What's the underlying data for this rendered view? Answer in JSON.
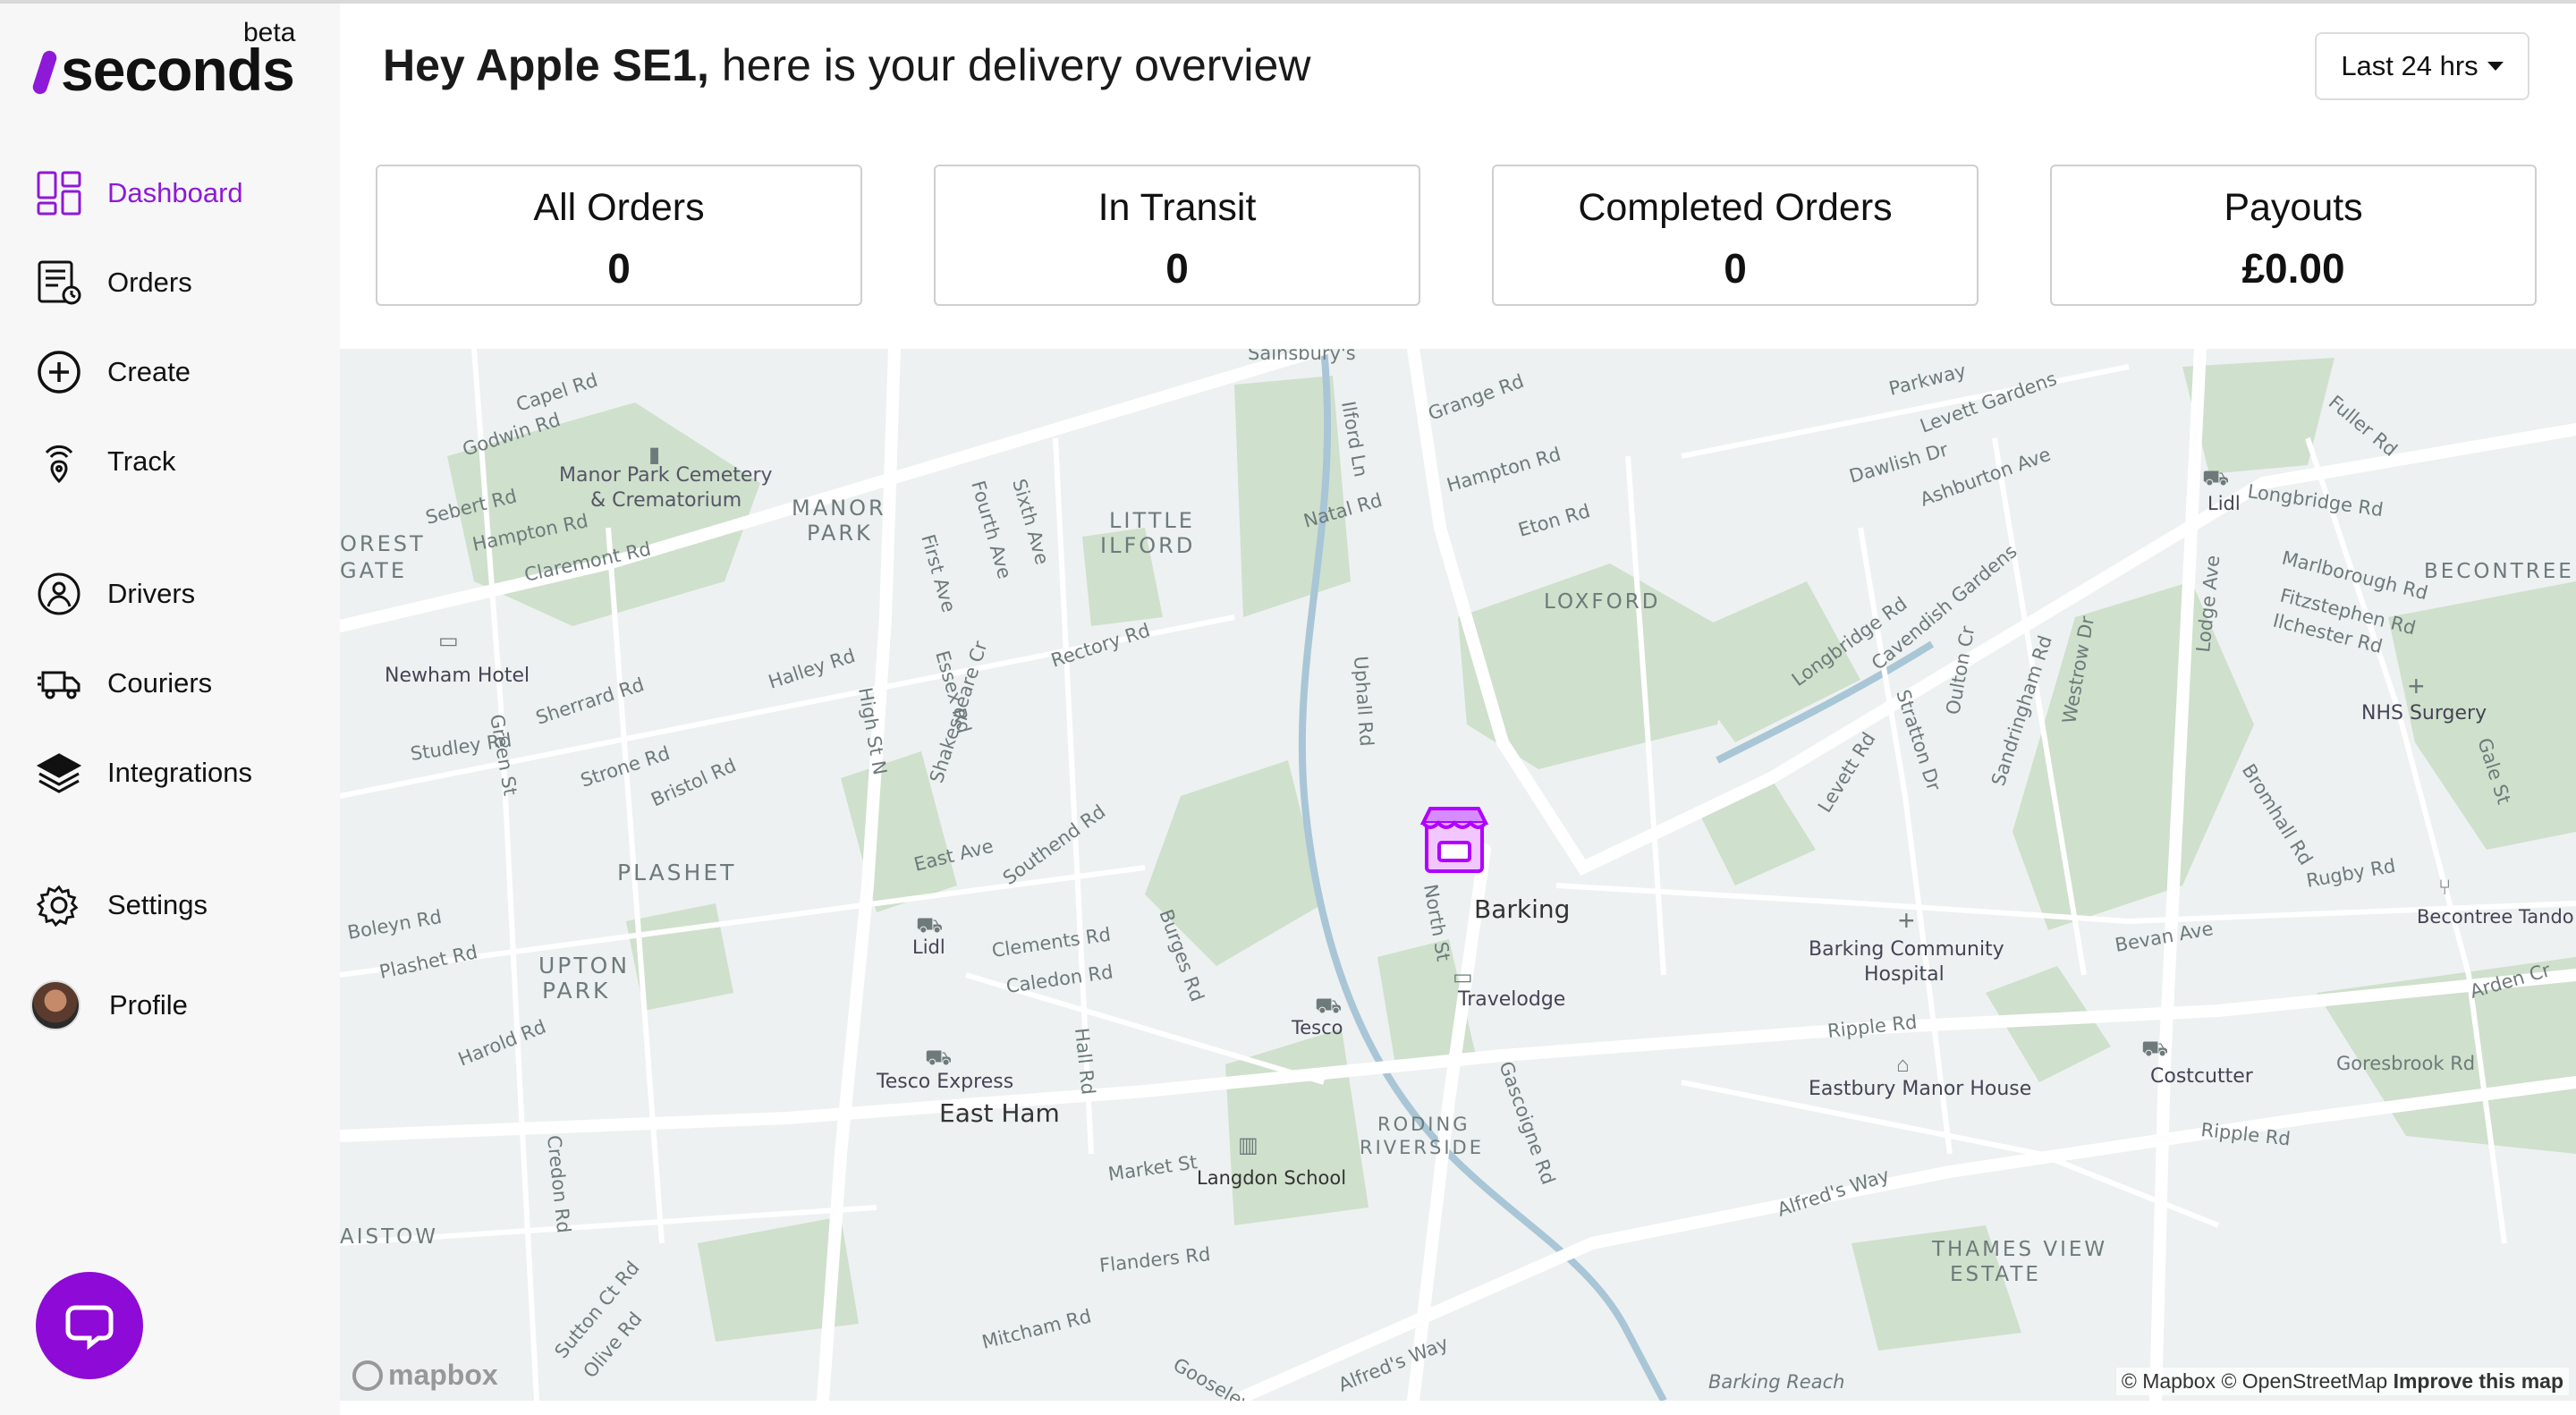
{
  "sidebar": {
    "logo_text": "seconds",
    "logo_badge": "beta",
    "items": [
      {
        "label": "Dashboard",
        "icon": "dashboard-icon"
      },
      {
        "label": "Orders",
        "icon": "orders-icon"
      },
      {
        "label": "Create",
        "icon": "create-icon"
      },
      {
        "label": "Track",
        "icon": "track-icon"
      },
      {
        "label": "Drivers",
        "icon": "drivers-icon"
      },
      {
        "label": "Couriers",
        "icon": "couriers-icon"
      },
      {
        "label": "Integrations",
        "icon": "integrations-icon"
      },
      {
        "label": "Settings",
        "icon": "settings-icon"
      },
      {
        "label": "Profile",
        "icon": "avatar"
      }
    ],
    "chat_icon": "chat-icon"
  },
  "header": {
    "greeting_name": "Hey Apple SE1,",
    "greeting_rest": " here is your delivery overview",
    "range_label": "Last 24 hrs"
  },
  "stats": [
    {
      "title": "All Orders",
      "value": "0"
    },
    {
      "title": "In Transit",
      "value": "0"
    },
    {
      "title": "Completed Orders",
      "value": "0"
    },
    {
      "title": "Payouts",
      "value": "£0.00"
    }
  ],
  "map": {
    "attribution_mapbox": "© Mapbox",
    "attribution_osm": "© OpenStreetMap",
    "improve": "Improve this map",
    "logo": "mapbox",
    "labels": {
      "sainsburys": "Sainsbury's",
      "capel_rd": "Capel Rd",
      "godwin_rd": "Godwin Rd",
      "cemetery1": "Manor Park Cemetery",
      "cemetery2": "& Crematorium",
      "manor": "MANOR",
      "park": "PARK",
      "little": "LITTLE",
      "ilford": "ILFORD",
      "forest": "OREST",
      "gate": "GATE",
      "newham_hotel": "Newham Hotel",
      "plashet": "PLASHET",
      "upton": "UPTON",
      "upton_park": "PARK",
      "loxford": "LOXFORD",
      "barking": "Barking",
      "travelodge": "Travelodge",
      "tesco": "Tesco",
      "tesco_express": "Tesco Express",
      "east_ham": "East Ham",
      "lidl1": "Lidl",
      "lidl2": "Lidl",
      "langdon": "Langdon School",
      "roding": "RODING",
      "riverside": "RIVERSIDE",
      "hospital1": "Barking Community",
      "hospital2": "Hospital",
      "eastbury": "Eastbury Manor House",
      "costcutter": "Costcutter",
      "thames": "THAMES VIEW",
      "estate": "ESTATE",
      "nhs": "NHS Surgery",
      "becontree": "BECONTREE",
      "becontree_tando": "Becontree Tando",
      "barking_reach": "Barking Reach",
      "alfreds_way": "Alfred's Way",
      "alfreds_way2": "Alfred's Way",
      "ripple_rd": "Ripple Rd",
      "ripple_rd2": "Ripple Rd",
      "longbridge_rd": "Longbridge Rd",
      "longbridge_rd2": "Longbridge Rd",
      "high_st_n": "High St N",
      "north_st": "North St",
      "ilford_ln": "Ilford Ln",
      "green_st": "Green St",
      "sherrard_rd": "Sherrard Rd",
      "strone_rd": "Strone Rd",
      "bristol_rd": "Bristol Rd",
      "studley_rd": "Studley Rd",
      "halley_rd": "Halley Rd",
      "rectory_rd": "Rectory Rd",
      "east_ave": "East Ave",
      "southend_rd": "Southend Rd",
      "clements_rd": "Clements Rd",
      "caledon_rd": "Caledon Rd",
      "hall_rd": "Hall Rd",
      "burges_rd": "Burges Rd",
      "market_st": "Market St",
      "flanders_rd": "Flanders Rd",
      "mitcham_rd": "Mitcham Rd",
      "gooseley_ln": "Gooseley Ln",
      "gascoigne_rd": "Gascoigne Rd",
      "uphall_rd": "Uphall Rd",
      "natal_rd": "Natal Rd",
      "grange_rd": "Grange Rd",
      "hampton_rd": "Hampton Rd",
      "eton_rd": "Eton Rd",
      "parkway": "Parkway",
      "levett_gardens": "Levett Gardens",
      "dawlish_dr": "Dawlish Dr",
      "ashburton_ave": "Ashburton Ave",
      "levett_rd": "Levett Rd",
      "bevan_ave": "Bevan Ave",
      "goresbrook_rd": "Goresbrook Rd",
      "arden_cr": "Arden Cr",
      "rugby_rd": "Rugby Rd",
      "marlborough_rd": "Marlborough Rd",
      "fitzstephen_rd": "Fitzstephen Rd",
      "ilchester_rd": "Ilchester Rd",
      "fuller_rd": "Fuller Rd",
      "lodge_ave": "Lodge Ave",
      "boleyn_rd": "Boleyn Rd",
      "plashet_rd": "Plashet Rd",
      "harold_rd": "Harold Rd",
      "credon_rd": "Credon Rd",
      "sutton_ct_rd": "Sutton Ct Rd",
      "olive_rd": "Olive Rd",
      "sebert_rd": "Sebert Rd",
      "hampton_rd2": "Hampton Rd",
      "claremont_rd": "Claremont Rd",
      "first_ave": "First Ave",
      "fourth_ave": "Fourth Ave",
      "sixth_ave": "Sixth Ave",
      "essex_rd": "Essex Rd",
      "cavendish_gardens": "Cavendish Gardens",
      "stratton_dr": "Stratton Dr",
      "oulton_cr": "Oulton Cr",
      "sandringham_rd": "Sandringham Rd",
      "westrow_dr": "Westrow Dr",
      "bromhall_rd": "Bromhall Rd",
      "gale_st": "Gale St",
      "shakespeare_cr": "Shakespeare Cr",
      "aistow": "AISTOW"
    }
  },
  "colors": {
    "accent": "#8e19d8",
    "map_bg": "#eef1f1",
    "park": "#cfe0cc",
    "water": "#a9c6d7"
  }
}
